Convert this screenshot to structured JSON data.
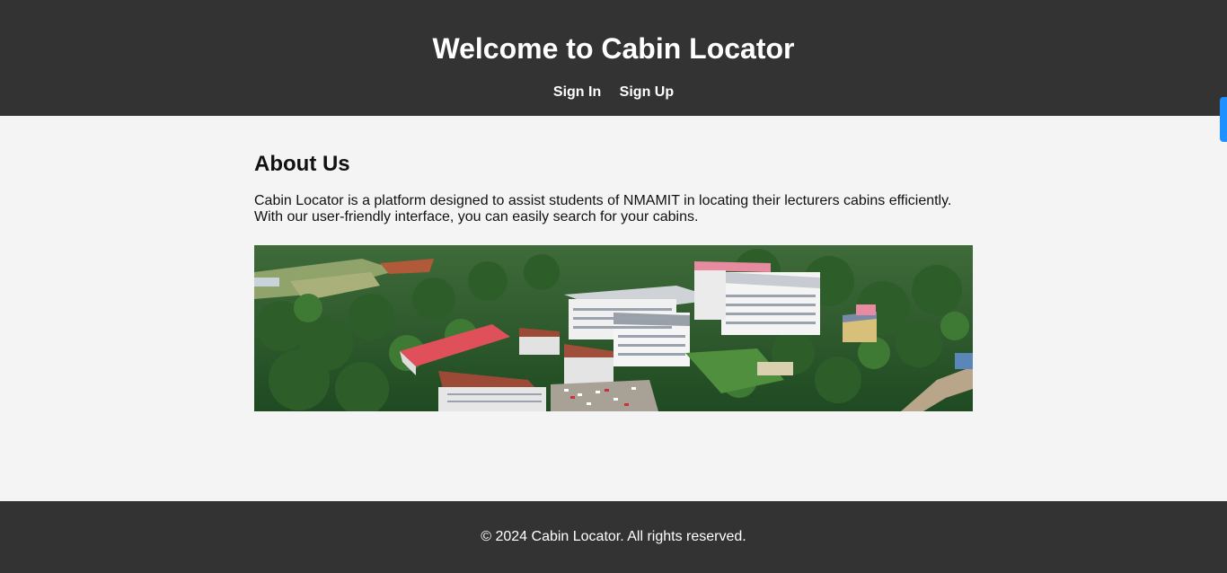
{
  "header": {
    "title": "Welcome to Cabin Locator",
    "nav": [
      {
        "label": "Sign In"
      },
      {
        "label": "Sign Up"
      }
    ]
  },
  "about": {
    "heading": "About Us",
    "line1": "Cabin Locator is a platform designed to assist students of NMAMIT in locating their lecturers cabins efficiently.",
    "line2": "With our user-friendly interface, you can easily search for your cabins."
  },
  "footer": {
    "copyright": "© 2024 Cabin Locator. All rights reserved."
  },
  "colors": {
    "header_bg": "#333333",
    "page_bg": "#f4f4f4",
    "accent": "#1e90ff"
  }
}
